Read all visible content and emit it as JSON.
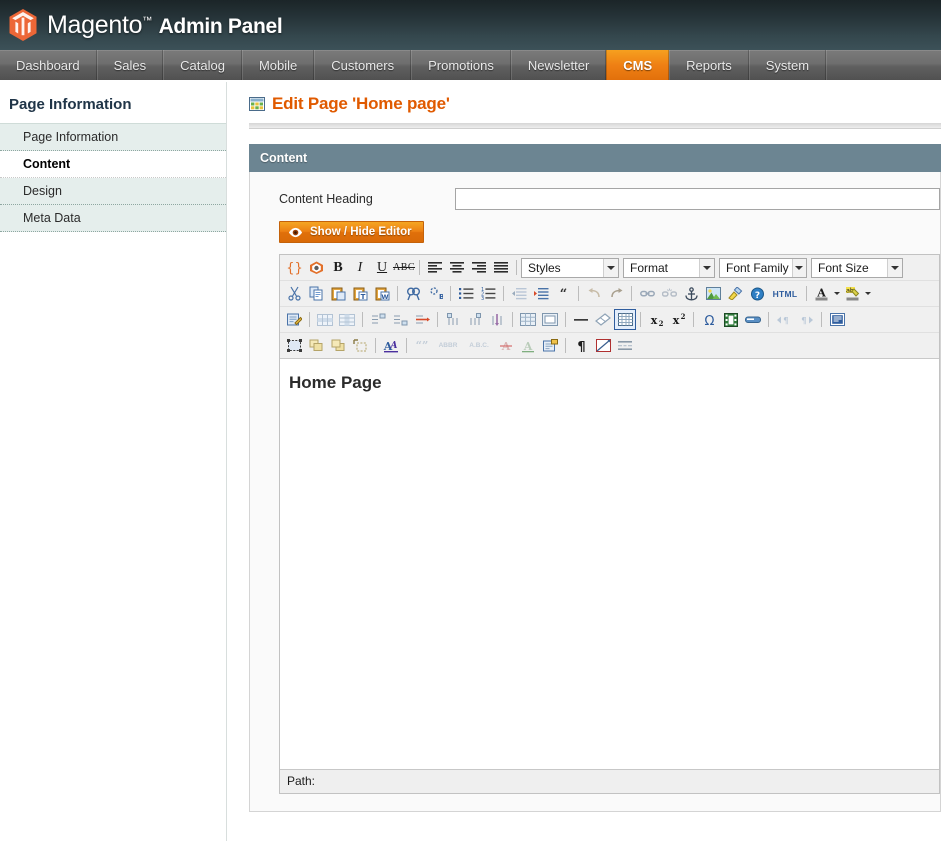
{
  "header": {
    "brand": "Magento",
    "trademark": "™",
    "panel_label": "Admin Panel",
    "logo_icon": "magento-hexagon-logo",
    "accent_color": "#e8602c",
    "bg_start": "#1b2528",
    "bg_end": "#3c5158"
  },
  "nav": {
    "items": [
      {
        "label": "Dashboard",
        "active": false
      },
      {
        "label": "Sales",
        "active": false
      },
      {
        "label": "Catalog",
        "active": false
      },
      {
        "label": "Mobile",
        "active": false
      },
      {
        "label": "Customers",
        "active": false
      },
      {
        "label": "Promotions",
        "active": false
      },
      {
        "label": "Newsletter",
        "active": false
      },
      {
        "label": "CMS",
        "active": true
      },
      {
        "label": "Reports",
        "active": false
      },
      {
        "label": "System",
        "active": false
      }
    ],
    "active_color": "#ef8014"
  },
  "sidebar": {
    "title": "Page Information",
    "items": [
      {
        "label": "Page Information",
        "active": false
      },
      {
        "label": "Content",
        "active": true
      },
      {
        "label": "Design",
        "active": false
      },
      {
        "label": "Meta Data",
        "active": false
      }
    ]
  },
  "page": {
    "title": "Edit Page 'Home page'",
    "title_icon": "grid-page-icon",
    "title_color": "#e05a00"
  },
  "panel": {
    "heading": "Content",
    "heading_bg": "#6c8592",
    "field": {
      "label": "Content Heading",
      "value": "",
      "placeholder": ""
    },
    "toggle_button": {
      "label": "Show / Hide Editor",
      "icon": "eye-icon"
    }
  },
  "editor": {
    "selects": [
      {
        "name": "styles",
        "label": "Styles"
      },
      {
        "name": "format",
        "label": "Format"
      },
      {
        "name": "font_family",
        "label": "Font Family"
      },
      {
        "name": "font_size",
        "label": "Font Size"
      }
    ],
    "toolbar_rows": [
      [
        {
          "type": "btn",
          "icon": "magento-variable-icon"
        },
        {
          "type": "btn",
          "icon": "magento-widget-icon"
        },
        {
          "type": "btn",
          "icon": "bold-icon",
          "text": "B"
        },
        {
          "type": "btn",
          "icon": "italic-icon",
          "text": "I"
        },
        {
          "type": "btn",
          "icon": "underline-icon",
          "text": "U"
        },
        {
          "type": "btn",
          "icon": "strikethrough-icon",
          "text": "ABC"
        },
        {
          "type": "sep"
        },
        {
          "type": "btn",
          "icon": "align-left-icon"
        },
        {
          "type": "btn",
          "icon": "align-center-icon"
        },
        {
          "type": "btn",
          "icon": "align-right-icon"
        },
        {
          "type": "btn",
          "icon": "align-justify-icon"
        },
        {
          "type": "sep"
        }
      ],
      [
        {
          "type": "btn",
          "icon": "cut-icon"
        },
        {
          "type": "btn",
          "icon": "copy-icon"
        },
        {
          "type": "btn",
          "icon": "paste-icon"
        },
        {
          "type": "btn",
          "icon": "paste-as-text-icon"
        },
        {
          "type": "btn",
          "icon": "paste-from-word-icon"
        },
        {
          "type": "sep"
        },
        {
          "type": "btn",
          "icon": "find-icon"
        },
        {
          "type": "btn",
          "icon": "find-replace-icon"
        },
        {
          "type": "sep"
        },
        {
          "type": "btn",
          "icon": "bullet-list-icon"
        },
        {
          "type": "btn",
          "icon": "numbered-list-icon"
        },
        {
          "type": "sep"
        },
        {
          "type": "btn",
          "icon": "outdent-icon"
        },
        {
          "type": "btn",
          "icon": "indent-icon"
        },
        {
          "type": "btn",
          "icon": "blockquote-icon"
        },
        {
          "type": "sep"
        },
        {
          "type": "btn",
          "icon": "undo-icon"
        },
        {
          "type": "btn",
          "icon": "redo-icon"
        },
        {
          "type": "sep"
        },
        {
          "type": "btn",
          "icon": "link-icon"
        },
        {
          "type": "btn",
          "icon": "unlink-icon"
        },
        {
          "type": "btn",
          "icon": "anchor-icon"
        },
        {
          "type": "btn",
          "icon": "insert-image-icon"
        },
        {
          "type": "btn",
          "icon": "cleanup-icon"
        },
        {
          "type": "btn",
          "icon": "help-icon"
        },
        {
          "type": "btn",
          "icon": "html-source-icon",
          "text": "HTML"
        },
        {
          "type": "sep"
        },
        {
          "type": "btn",
          "icon": "text-color-icon"
        },
        {
          "type": "btn",
          "icon": "background-color-icon"
        }
      ],
      [
        {
          "type": "btn",
          "icon": "edit-css-icon"
        },
        {
          "type": "sep"
        },
        {
          "type": "btn",
          "icon": "table-row-properties-icon"
        },
        {
          "type": "btn",
          "icon": "table-cell-properties-icon"
        },
        {
          "type": "sep"
        },
        {
          "type": "btn",
          "icon": "insert-row-before-icon"
        },
        {
          "type": "btn",
          "icon": "insert-row-after-icon"
        },
        {
          "type": "btn",
          "icon": "delete-row-icon"
        },
        {
          "type": "sep"
        },
        {
          "type": "btn",
          "icon": "insert-column-before-icon"
        },
        {
          "type": "btn",
          "icon": "insert-column-after-icon"
        },
        {
          "type": "btn",
          "icon": "delete-column-icon"
        },
        {
          "type": "sep"
        },
        {
          "type": "btn",
          "icon": "split-cells-icon"
        },
        {
          "type": "btn",
          "icon": "merge-cells-icon"
        },
        {
          "type": "sep"
        },
        {
          "type": "btn",
          "icon": "horizontal-rule-icon"
        },
        {
          "type": "btn",
          "icon": "remove-format-icon"
        },
        {
          "type": "btn",
          "icon": "toggle-borders-icon",
          "active": true
        },
        {
          "type": "sep"
        },
        {
          "type": "btn",
          "icon": "subscript-icon"
        },
        {
          "type": "btn",
          "icon": "superscript-icon"
        },
        {
          "type": "sep"
        },
        {
          "type": "btn",
          "icon": "special-character-icon"
        },
        {
          "type": "btn",
          "icon": "insert-media-icon"
        },
        {
          "type": "btn",
          "icon": "insert-date-icon"
        },
        {
          "type": "sep"
        },
        {
          "type": "btn",
          "icon": "ltr-icon"
        },
        {
          "type": "btn",
          "icon": "rtl-icon"
        },
        {
          "type": "sep"
        },
        {
          "type": "btn",
          "icon": "fullscreen-icon"
        }
      ],
      [
        {
          "type": "btn",
          "icon": "select-all-icon"
        },
        {
          "type": "btn",
          "icon": "insert-layer-icon"
        },
        {
          "type": "btn",
          "icon": "move-forward-icon"
        },
        {
          "type": "btn",
          "icon": "absolute-position-icon"
        },
        {
          "type": "sep"
        },
        {
          "type": "btn",
          "icon": "style-props-icon"
        },
        {
          "type": "sep"
        },
        {
          "type": "btn",
          "icon": "citation-icon"
        },
        {
          "type": "btn",
          "icon": "abbreviation-icon",
          "text": "ABBR"
        },
        {
          "type": "btn",
          "icon": "acronym-icon",
          "text": "A.B.C."
        },
        {
          "type": "btn",
          "icon": "delete-span-icon"
        },
        {
          "type": "btn",
          "icon": "insert-span-icon"
        },
        {
          "type": "btn",
          "icon": "attributes-icon"
        },
        {
          "type": "sep"
        },
        {
          "type": "btn",
          "icon": "show-blocks-icon"
        },
        {
          "type": "btn",
          "icon": "visual-aid-icon"
        },
        {
          "type": "btn",
          "icon": "page-break-icon"
        }
      ]
    ],
    "content_html_text": "Home Page",
    "status": {
      "label": "Path:",
      "value": ""
    }
  }
}
